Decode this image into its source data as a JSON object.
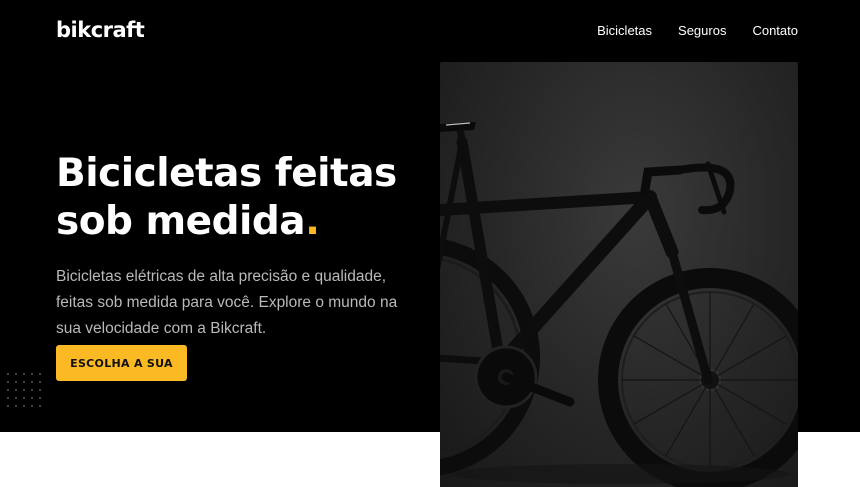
{
  "brand": {
    "name": "bikcraft"
  },
  "nav": {
    "items": [
      "Bicicletas",
      "Seguros",
      "Contato"
    ]
  },
  "hero": {
    "title_main": "Bicicletas feitas sob medida",
    "title_dot": ".",
    "description": "Bicicletas elétricas de alta precisão e qualidade, feitas sob medida para você. Explore o mundo na sua velocidade com a Bikcraft.",
    "cta_label": "ESCOLHA A SUA"
  },
  "colors": {
    "accent": "#fbb924",
    "hero_bg": "#000000",
    "text_muted": "#b9b9b9"
  },
  "icons": {
    "decoration": "dot-grid-icon"
  }
}
